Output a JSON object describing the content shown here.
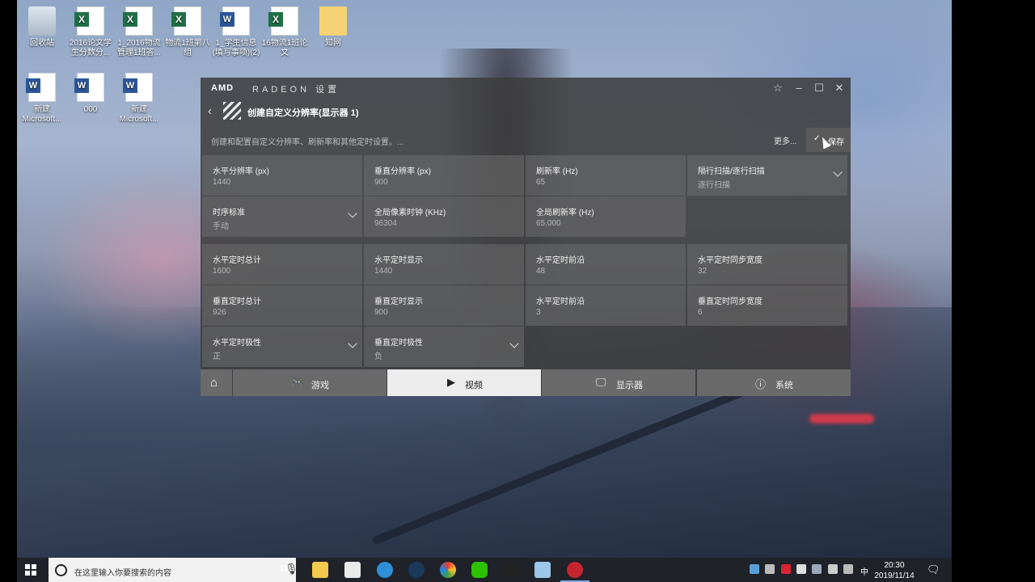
{
  "desktop": {
    "icons": [
      {
        "name": "recycle-bin",
        "label": "回收站"
      },
      {
        "name": "excel-1",
        "label": "2016论文学生分数分..."
      },
      {
        "name": "excel-2",
        "label": "1_2016物流管理1班答..."
      },
      {
        "name": "excel-3",
        "label": "物流1班第八组"
      },
      {
        "name": "word-1",
        "label": "1_学生信息(填写事项)(2)"
      },
      {
        "name": "excel-4",
        "label": "16物流1班论文"
      },
      {
        "name": "folder-1",
        "label": "知网"
      },
      {
        "name": "word-2",
        "label": "新建 Microsoft..."
      },
      {
        "name": "word-3",
        "label": "000"
      },
      {
        "name": "word-4",
        "label": "新建 Microsoft..."
      }
    ]
  },
  "window": {
    "brand": "AMD",
    "brand_suffix": "RADEON 设置",
    "title": "创建自定义分辨率(显示器 1)",
    "subtitle": "创建和配置自定义分辨率、刷新率和其他定时设置。...",
    "more_label": "更多...",
    "save_label": "保存",
    "row1": [
      {
        "label": "水平分辨率 (px)",
        "value": "1440"
      },
      {
        "label": "垂直分辨率 (px)",
        "value": "900"
      },
      {
        "label": "刷新率 (Hz)",
        "value": "65"
      },
      {
        "label": "隔行扫描/逐行扫描",
        "value": "逐行扫描"
      }
    ],
    "row2": [
      {
        "label": "时序标准",
        "value": "手动"
      },
      {
        "label": "全局像素时钟 (KHz)",
        "value": "96304"
      },
      {
        "label": "全局刷新率 (Hz)",
        "value": "65.000"
      }
    ],
    "row3": [
      {
        "label": "水平定时总计",
        "value": "1600"
      },
      {
        "label": "水平定时显示",
        "value": "1440"
      },
      {
        "label": "水平定时前沿",
        "value": "48"
      },
      {
        "label": "水平定时同步宽度",
        "value": "32"
      }
    ],
    "row4": [
      {
        "label": "垂直定时总计",
        "value": "926"
      },
      {
        "label": "垂直定时显示",
        "value": "900"
      },
      {
        "label": "水平定时前沿",
        "value": "3"
      },
      {
        "label": "垂直定时同步宽度",
        "value": "6"
      }
    ],
    "row5": [
      {
        "label": "水平定时极性",
        "value": "正"
      },
      {
        "label": "垂直定时极性",
        "value": "负"
      }
    ],
    "nav": {
      "games": "游戏",
      "video": "视频",
      "display": "显示器",
      "system": "系统"
    }
  },
  "taskbar": {
    "search_placeholder": "在这里输入你要搜索的内容",
    "ime": "中",
    "time": "20:30",
    "date": "2019/11/14"
  }
}
